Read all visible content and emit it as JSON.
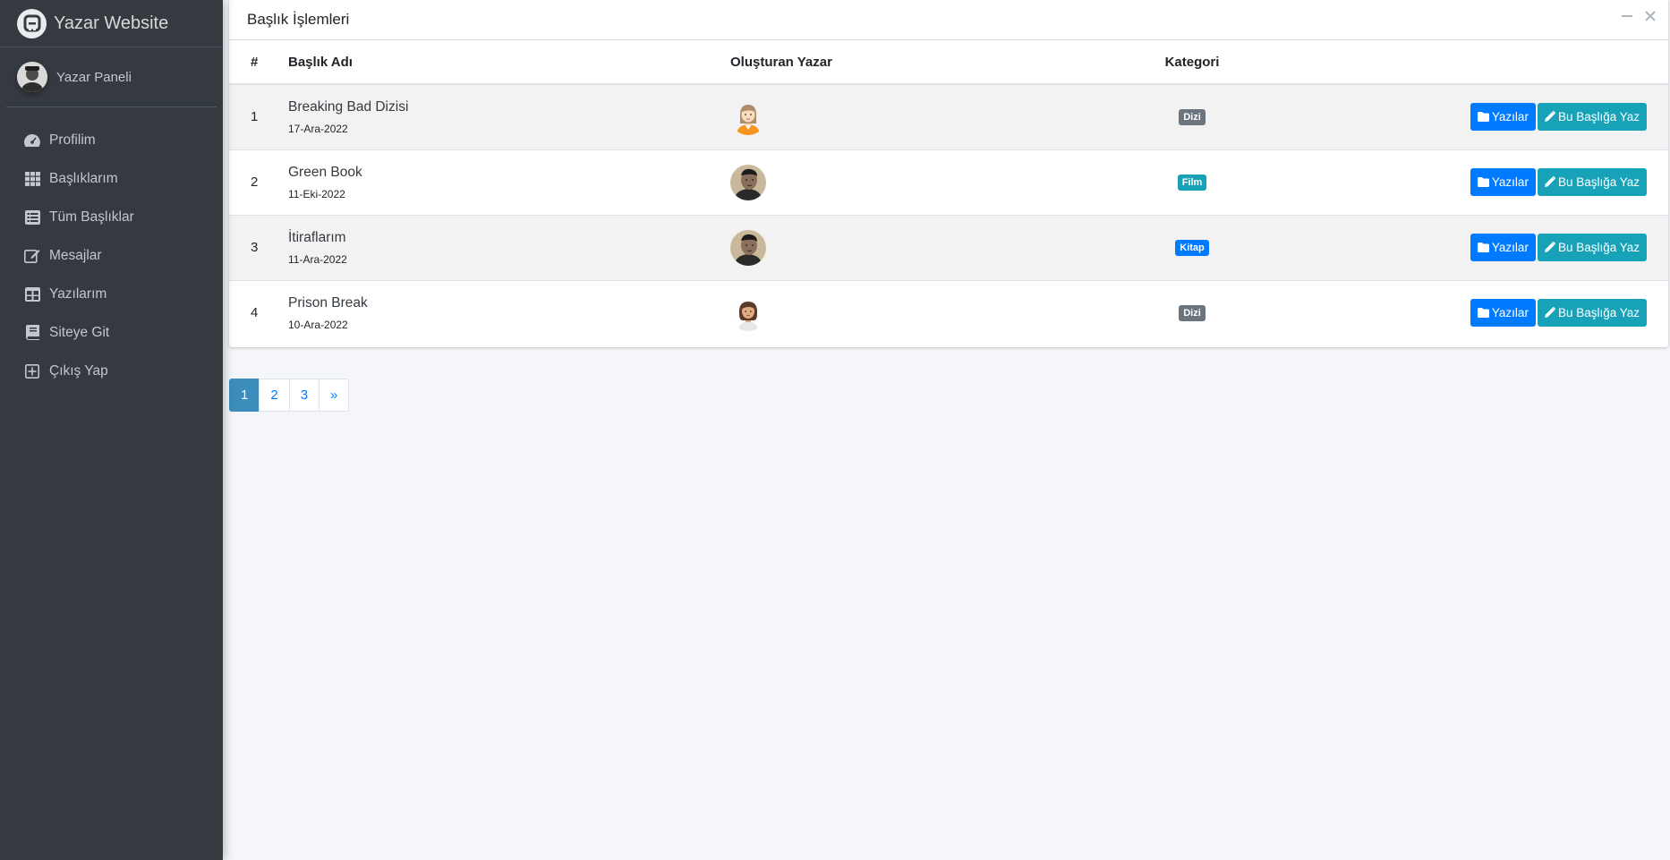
{
  "brand": {
    "title": "Yazar Website"
  },
  "user": {
    "name": "Yazar Paneli"
  },
  "sidebar": {
    "items": [
      {
        "label": "Profilim",
        "icon": "tachometer-icon"
      },
      {
        "label": "Başlıklarım",
        "icon": "grid-icon"
      },
      {
        "label": "Tüm Başlıklar",
        "icon": "list-icon"
      },
      {
        "label": "Mesajlar",
        "icon": "edit-icon"
      },
      {
        "label": "Yazılarım",
        "icon": "table-icon"
      },
      {
        "label": "Siteye Git",
        "icon": "book-icon"
      },
      {
        "label": "Çıkış Yap",
        "icon": "plus-square-icon"
      }
    ]
  },
  "card": {
    "title": "Başlık İşlemleri",
    "collapse_icon": "minus-icon",
    "close_icon": "times-icon"
  },
  "table": {
    "headers": {
      "num": "#",
      "name": "Başlık Adı",
      "author": "Oluşturan Yazar",
      "category": "Kategori"
    },
    "rows": [
      {
        "num": "1",
        "title": "Breaking Bad Dizisi",
        "date": "17-Ara-2022",
        "author_avatar": "female-avatar-orange",
        "category": "Dizi",
        "category_color": "#6c757d"
      },
      {
        "num": "2",
        "title": "Green Book",
        "date": "11-Eki-2022",
        "author_avatar": "male-photo-avatar",
        "category": "Film",
        "category_color": "#17a2b8"
      },
      {
        "num": "3",
        "title": "İtiraflarım",
        "date": "11-Ara-2022",
        "author_avatar": "male-photo-avatar",
        "category": "Kitap",
        "category_color": "#007bff"
      },
      {
        "num": "4",
        "title": "Prison Break",
        "date": "10-Ara-2022",
        "author_avatar": "female-avatar-brown",
        "category": "Dizi",
        "category_color": "#6c757d"
      }
    ],
    "btn_posts": "Yazılar",
    "btn_write": "Bu Başlığa Yaz"
  },
  "pagination": {
    "pages": [
      "1",
      "2",
      "3"
    ],
    "next": "»",
    "active": "1"
  },
  "colors": {
    "sidebar": "#343a40",
    "primary": "#007bff",
    "info": "#17a2b8",
    "secondary": "#6c757d",
    "page_active": "#3c8dbc"
  }
}
